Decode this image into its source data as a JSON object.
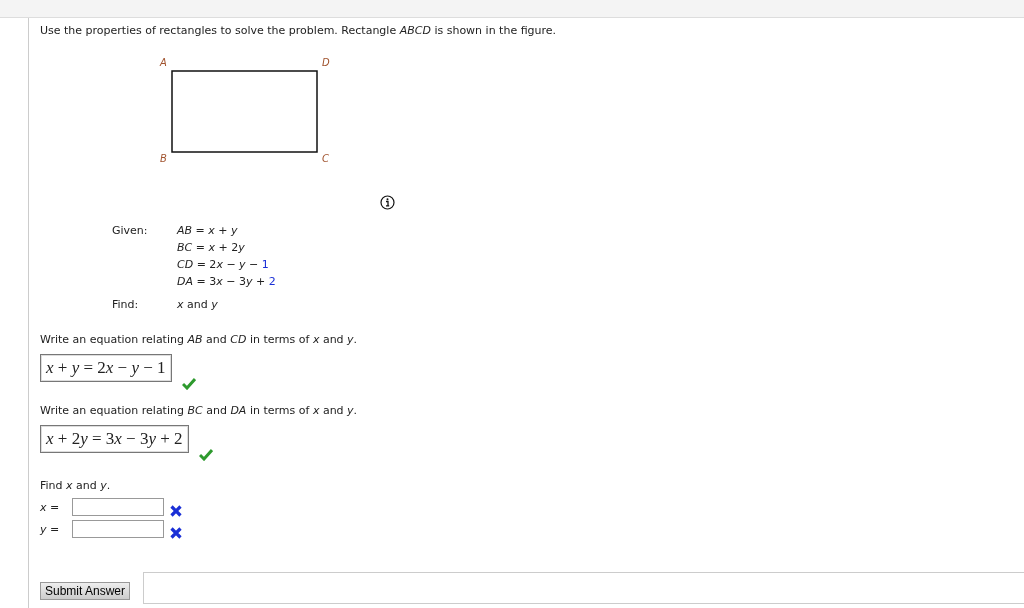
{
  "prompt": "Use the properties of rectangles to solve the problem. Rectangle *ABCD* is shown in the figure.",
  "figure": {
    "vertices": [
      "A",
      "D",
      "B",
      "C"
    ]
  },
  "given": {
    "label": "Given:",
    "lines": [
      {
        "text": "AB = x + y"
      },
      {
        "text": "BC = x + 2y"
      },
      {
        "text": "CD = 2x − y − ",
        "highlight": "1"
      },
      {
        "text": "DA = 3x − 3y + ",
        "highlight": "2"
      }
    ]
  },
  "find": {
    "label": "Find:",
    "text": "*x* and *y*"
  },
  "questions": [
    {
      "kind": "equation",
      "prompt": "Write an equation relating *AB* and *CD* in terms of *x* and *y*.",
      "answer": "x + y = 2x − y − 1",
      "correct": true
    },
    {
      "kind": "equation",
      "prompt": "Write an equation relating *BC* and *DA* in terms of *x* and *y*.",
      "answer": "x + 2y = 3x − 3y + 2",
      "correct": true
    },
    {
      "kind": "solve",
      "prompt": "Find *x* and *y*.",
      "fields": [
        {
          "label": "*x* =",
          "correct": false
        },
        {
          "label": "*y* =",
          "correct": false
        }
      ]
    }
  ],
  "submit_button": "Submit Answer"
}
